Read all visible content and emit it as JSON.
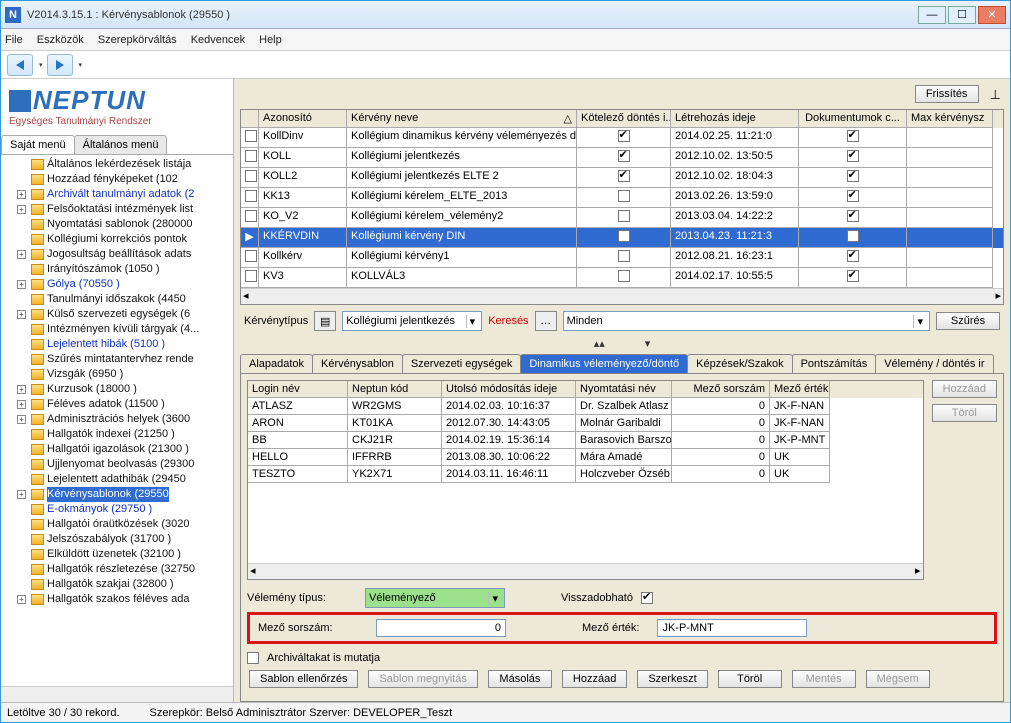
{
  "window": {
    "title": "V2014.3.15.1 : Kérvénysablonok  (29550  )"
  },
  "menu": {
    "file": "File",
    "tools": "Eszközök",
    "role": "Szerepkörváltás",
    "fav": "Kedvencek",
    "help": "Help"
  },
  "logo": {
    "name": "NEPTUN",
    "sub": "Egységes Tanulmányi Rendszer"
  },
  "leftTabs": {
    "own": "Saját menü",
    "general": "Általános menü"
  },
  "tree": [
    {
      "t": "Általános lekérdezések listája"
    },
    {
      "t": "Hozzáad fényképeket (102"
    },
    {
      "t": "Archivált tanulmányi adatok (2",
      "blue": true,
      "exp": "+"
    },
    {
      "t": "Felsőoktatási intézmények list",
      "exp": "+"
    },
    {
      "t": "Nyomtatási sablonok (280000"
    },
    {
      "t": "Kollégiumi korrekciós pontok"
    },
    {
      "t": "Jogosultság beállítások adats",
      "exp": "+"
    },
    {
      "t": "Irányítószámok (1050  )"
    },
    {
      "t": "Gólya (70550  )",
      "blue": true,
      "exp": "+"
    },
    {
      "t": "Tanulmányi időszakok (4450"
    },
    {
      "t": "Külső szervezeti egységek (6",
      "exp": "+"
    },
    {
      "t": "Intézményen kívüli tárgyak (4..."
    },
    {
      "t": "Lejelentett hibák (5100  )",
      "blue": true
    },
    {
      "t": "Szűrés mintatantervhez rende"
    },
    {
      "t": "Vizsgák (6950  )"
    },
    {
      "t": "Kurzusok (18000  )",
      "exp": "+"
    },
    {
      "t": "Féléves adatok (11500  )",
      "exp": "+"
    },
    {
      "t": "Adminisztrációs helyek (3600",
      "exp": "+"
    },
    {
      "t": "Hallgatók indexei (21250  )"
    },
    {
      "t": "Hallgatói igazolások (21300  )"
    },
    {
      "t": "Ujjlenyomat beolvasás (29300"
    },
    {
      "t": "Lejelentett adathibák (29450"
    },
    {
      "t": "Kérvénysablonok (29550",
      "sel": true,
      "exp": "+"
    },
    {
      "t": "E-okmányok (29750  )",
      "blue": true
    },
    {
      "t": "Hallgatói óraütközések (3020"
    },
    {
      "t": "Jelszószabályok (31700  )"
    },
    {
      "t": "Elküldött üzenetek (32100  )"
    },
    {
      "t": "Hallgatók részletezése (32750"
    },
    {
      "t": "Hallgatók szakjai (32800  )"
    },
    {
      "t": "Hallgatók szakos féléves ada",
      "exp": "+"
    }
  ],
  "topGrid": {
    "refresh": "Frissítés",
    "headers": {
      "a": "",
      "b": "Azonosító",
      "c": "Kérvény neve",
      "d": "Kötelező döntés i...",
      "e": "Létrehozás ideje",
      "f": "Dokumentumok c...",
      "g": "Max kérvénysz"
    },
    "rows": [
      {
        "b": "KollDinv",
        "c": "Kollégium dinamikus kérvény véleményezés d",
        "d": true,
        "e": "2014.02.25. 11:21:0",
        "f": true
      },
      {
        "b": "KOLL",
        "c": "Kollégiumi jelentkezés",
        "d": true,
        "e": "2012.10.02. 13:50:5",
        "f": true
      },
      {
        "b": "KOLL2",
        "c": "Kollégiumi jelentkezés ELTE 2",
        "d": true,
        "e": "2012.10.02. 18:04:3",
        "f": true
      },
      {
        "b": "KK13",
        "c": "Kollégiumi kérelem_ELTE_2013",
        "d": false,
        "e": "2013.02.26. 13:59:0",
        "f": true
      },
      {
        "b": "KO_V2",
        "c": "Kollégiumi kérelem_vélemény2",
        "d": false,
        "e": "2013.03.04. 14:22:2",
        "f": true
      },
      {
        "b": "KKÉRVDIN",
        "c": "Kollégiumi kérvény DIN",
        "d": true,
        "e": "2013.04.23. 11:21:3",
        "f": true,
        "sel": true,
        "dot": true
      },
      {
        "b": "Kollkérv",
        "c": "Kollégiumi kérvény1",
        "d": false,
        "e": "2012.08.21. 16:23:1",
        "f": true
      },
      {
        "b": "KV3",
        "c": "KOLLVÁL3",
        "d": false,
        "e": "2014.02.17. 10:55:5",
        "f": true
      }
    ]
  },
  "filter": {
    "label": "Kérvénytípus",
    "combo": "Kollégiumi jelentkezés",
    "search": "Keresés",
    "all": "Minden",
    "filterBtn": "Szűrés"
  },
  "tabs": {
    "a": "Alapadatok",
    "b": "Kérvénysablon",
    "c": "Szervezeti egységek",
    "d": "Dinamikus véleményező/döntő",
    "e": "Képzések/Szakok",
    "f": "Pontszámítás",
    "g": "Vélemény / döntés ir"
  },
  "panelGrid": {
    "headers": {
      "a": "Login név",
      "b": "Neptun kód",
      "c": "Utolsó módosítás ideje",
      "d": "Nyomtatási név",
      "e": "Mező sorszám",
      "f": "Mező érték"
    },
    "rows": [
      {
        "a": "ATLASZ",
        "b": "WR2GMS",
        "c": "2014.02.03. 10:16:37",
        "d": "Dr. Szalbek Atlasz",
        "e": "0",
        "f": "JK-F-NAN"
      },
      {
        "a": "ARON",
        "b": "KT01KA",
        "c": "2012.07.30. 14:43:05",
        "d": "Molnár Garibaldi",
        "e": "0",
        "f": "JK-F-NAN"
      },
      {
        "a": "BB",
        "b": "CKJ21R",
        "c": "2014.02.19. 15:36:14",
        "d": "Barasovich Barszos",
        "e": "0",
        "f": "JK-P-MNT"
      },
      {
        "a": "HELLO",
        "b": "IFFRRB",
        "c": "2013.08.30. 10:06:22",
        "d": "Mára Amadé",
        "e": "0",
        "f": "UK"
      },
      {
        "a": "TESZTO",
        "b": "YK2X71",
        "c": "2014.03.11. 16:46:11",
        "d": "Holczveber Özséb",
        "e": "0",
        "f": "UK"
      }
    ],
    "add": "Hozzáad",
    "del": "Töröl"
  },
  "form": {
    "velTipusL": "Vélemény típus:",
    "velTipusV": "Véleményező",
    "visszaL": "Visszadobható",
    "mezoSorL": "Mező sorszám:",
    "mezoSorV": "0",
    "mezoErtL": "Mező érték:",
    "mezoErtV": "JK-P-MNT",
    "archL": "Archiváltakat is mutatja"
  },
  "buttons": {
    "a": "Sablon ellenőrzés",
    "b": "Sablon megnyitás",
    "c": "Másolás",
    "d": "Hozzáad",
    "e": "Szerkeszt",
    "f": "Töröl",
    "g": "Mentés",
    "h": "Mégsem"
  },
  "status": {
    "rec": "Letöltve 30 / 30 rekord.",
    "role": "Szerepkör: Belső Adminisztrátor   Szerver: DEVELOPER_Teszt"
  }
}
